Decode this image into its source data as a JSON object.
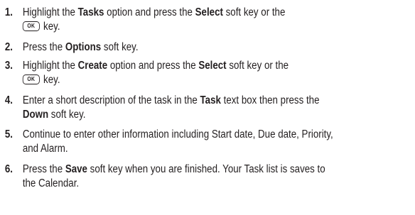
{
  "steps": [
    {
      "num": "1.",
      "l1a": "Highlight the ",
      "l1b": "Tasks",
      "l1c": " option and press the ",
      "l1d": "Select",
      "l1e": " soft key or the",
      "key_label": "OK",
      "l2": "key."
    },
    {
      "num": "2.",
      "a": "Press the ",
      "b": "Options",
      "c": " soft key."
    },
    {
      "num": "3.",
      "l1a": "Highlight the ",
      "l1b": "Create",
      "l1c": " option and press the ",
      "l1d": "Select",
      "l1e": " soft key or the",
      "key_label": "OK",
      "l2": "key."
    },
    {
      "num": "4.",
      "l1a": "Enter a short description of the task in the ",
      "l1b": "Task",
      "l1c": " text box then press the",
      "l2a": "Down",
      "l2b": " soft key."
    },
    {
      "num": "5.",
      "l1": "Continue to enter other information including Start date, Due date, Priority,",
      "l2": "and Alarm."
    },
    {
      "num": "6.",
      "l1a": "Press the ",
      "l1b": "Save",
      "l1c": " soft key when you are finished. Your Task list is saves to",
      "l2": "the Calendar."
    }
  ]
}
